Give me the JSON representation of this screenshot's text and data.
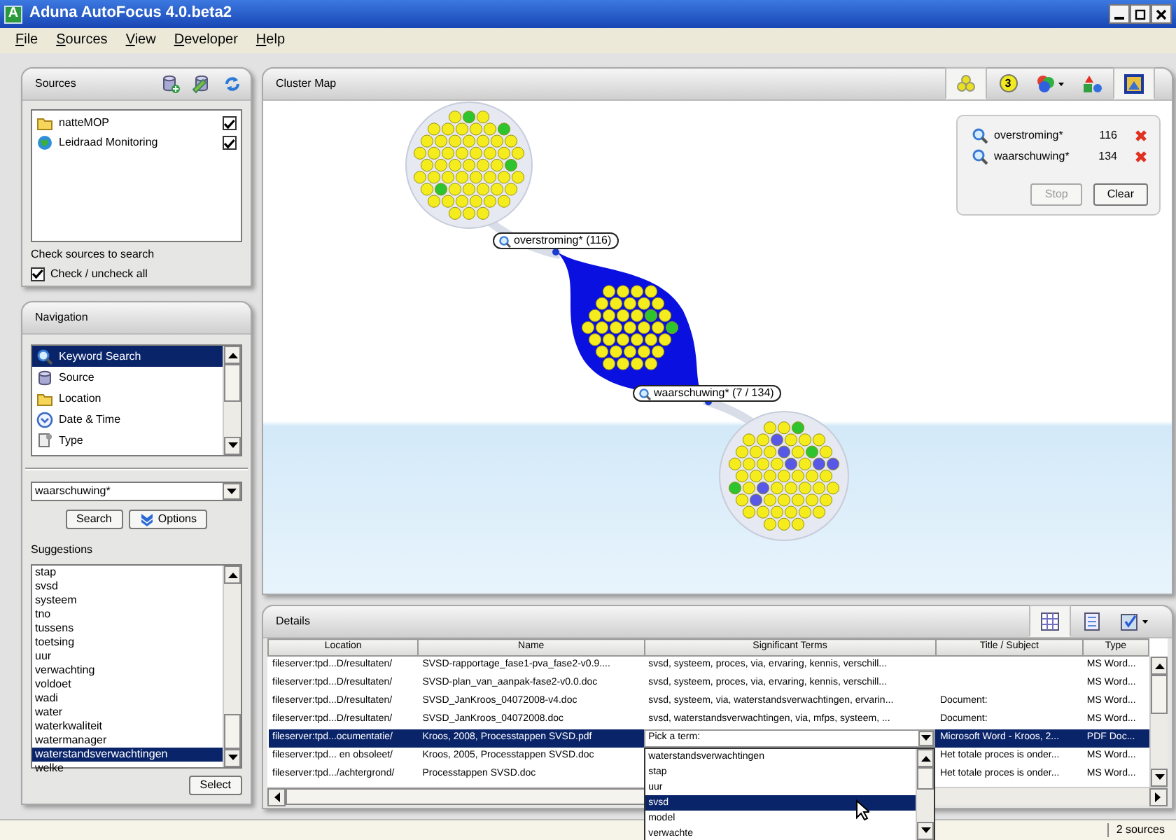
{
  "window": {
    "title": "Aduna AutoFocus 4.0.beta2",
    "logo": "A"
  },
  "menu": [
    {
      "label": "File",
      "mnemonic_underlined": true
    },
    {
      "label": "Sources",
      "mnemonic_underlined": true
    },
    {
      "label": "View",
      "mnemonic_underlined": true
    },
    {
      "label": "Developer",
      "mnemonic_underlined": true
    },
    {
      "label": "Help",
      "mnemonic_underlined": true
    }
  ],
  "sources": {
    "title": "Sources",
    "items": [
      {
        "label": "natteMOP",
        "kind": "folder",
        "checked": true
      },
      {
        "label": "Leidraad Monitoring",
        "kind": "web",
        "checked": true
      }
    ],
    "hint": "Check sources to search",
    "check_all": {
      "label": "Check / uncheck all",
      "checked": true
    }
  },
  "navigation": {
    "title": "Navigation",
    "items": [
      {
        "label": "Keyword Search",
        "kind": "search",
        "selected": true
      },
      {
        "label": "Source",
        "kind": "source",
        "selected": false
      },
      {
        "label": "Location",
        "kind": "location",
        "selected": false
      },
      {
        "label": "Date & Time",
        "kind": "datetime",
        "selected": false
      },
      {
        "label": "Type",
        "kind": "type",
        "selected": false
      }
    ],
    "query": "waarschuwing*",
    "buttons": [
      "Search",
      "Options"
    ],
    "suggestions_label": "Suggestions",
    "suggestions": [
      {
        "label": "stap",
        "selected": false
      },
      {
        "label": "svsd",
        "selected": false
      },
      {
        "label": "systeem",
        "selected": false
      },
      {
        "label": "tno",
        "selected": false
      },
      {
        "label": "tussens",
        "selected": false
      },
      {
        "label": "toetsing",
        "selected": false
      },
      {
        "label": "uur",
        "selected": false
      },
      {
        "label": "verwachting",
        "selected": false
      },
      {
        "label": "voldoet",
        "selected": false
      },
      {
        "label": "wadi",
        "selected": false
      },
      {
        "label": "water",
        "selected": false
      },
      {
        "label": "waterkwaliteit",
        "selected": false
      },
      {
        "label": "watermanager",
        "selected": false
      },
      {
        "label": "waterstandsverwachtingen",
        "selected": true
      },
      {
        "label": "welke",
        "selected": false
      }
    ],
    "select_button": "Select"
  },
  "cluster_map": {
    "title": "Cluster Map",
    "toolbar": [
      {
        "kind": "clusters",
        "selected": true
      },
      {
        "kind": "count",
        "text": "3",
        "selected": false
      },
      {
        "kind": "colors",
        "selected": false
      },
      {
        "kind": "shapes",
        "selected": false
      },
      {
        "kind": "export",
        "selected": true
      }
    ],
    "labels": [
      "overstroming* (116)",
      "waarschuwing* (7 / 134)"
    ],
    "legend": {
      "queries": [
        {
          "term": "overstroming*",
          "count": "116"
        },
        {
          "term": "waarschuwing*",
          "count": "134"
        }
      ],
      "buttons": [
        {
          "label": "Stop",
          "disabled": true
        },
        {
          "label": "Clear",
          "disabled": false
        }
      ]
    }
  },
  "details": {
    "title": "Details",
    "toolbar": [
      {
        "kind": "grid",
        "selected": true
      },
      {
        "kind": "list",
        "selected": false
      },
      {
        "kind": "columns",
        "selected": false
      }
    ],
    "columns": [
      "Location",
      "Name",
      "Significant Terms",
      "Title / Subject",
      "Type"
    ],
    "rows": [
      {
        "location": "fileserver:tpd...D/resultaten/",
        "name": "SVSD-rapportage_fase1-pva_fase2-v0.9....",
        "terms": "svsd, systeem, proces, via, ervaring, kennis, verschill...",
        "type": "MS Word...",
        "selected": false
      },
      {
        "location": "fileserver:tpd...D/resultaten/",
        "name": "SVSD-plan_van_aanpak-fase2-v0.0.doc",
        "terms": "svsd, systeem, proces, via, ervaring, kennis, verschill...",
        "type": "MS Word...",
        "selected": false
      },
      {
        "location": "fileserver:tpd...D/resultaten/",
        "name": "SVSD_JanKroos_04072008-v4.doc",
        "terms": "svsd, systeem, via, waterstandsverwachtingen, ervarin...",
        "title": "Document:",
        "type": "MS Word...",
        "selected": false
      },
      {
        "location": "fileserver:tpd...D/resultaten/",
        "name": "SVSD_JanKroos_04072008.doc",
        "terms": "svsd, waterstandsverwachtingen, via, mfps, systeem, ...",
        "title": "Document:",
        "type": "MS Word...",
        "selected": false
      },
      {
        "location": "fileserver:tpd...ocumentatie/",
        "name": "Kroos, 2008, Processtappen SVSD.pdf",
        "picker": "Pick a term:",
        "title": "Microsoft Word - Kroos, 2...",
        "type": "PDF Doc...",
        "selected": true
      },
      {
        "location": "fileserver:tpd... en obsoleet/",
        "name": "Kroos, 2005, Processtappen SVSD.doc",
        "title": "Het totale proces is onder...",
        "type": "MS Word...",
        "selected": false
      },
      {
        "location": "fileserver:tpd.../achtergrond/",
        "name": "Processtappen SVSD.doc",
        "title": "Het totale proces is onder...",
        "type": "MS Word...",
        "selected": false
      }
    ],
    "term_options": [
      {
        "label": "waterstandsverwachtingen",
        "selected": false
      },
      {
        "label": "stap",
        "selected": false
      },
      {
        "label": "uur",
        "selected": false
      },
      {
        "label": "svsd",
        "selected": true
      },
      {
        "label": "model",
        "selected": false
      },
      {
        "label": "verwachte",
        "selected": false
      }
    ]
  },
  "status_bar": {
    "text": "2 sources"
  }
}
